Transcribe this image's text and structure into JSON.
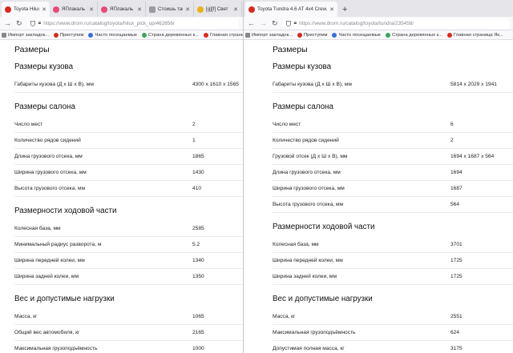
{
  "left": {
    "tabs": [
      {
        "title": "Toyota Hilux 1.9",
        "fav": "red",
        "active": true
      },
      {
        "title": "ЯПлакаль",
        "fav": "pink",
        "active": false
      },
      {
        "title": "ЯПлакаль - Р...",
        "fav": "pink",
        "active": false
      },
      {
        "title": "Стоишь так на...",
        "fav": "gray",
        "active": false
      },
      {
        "title": "[g][f] Свет",
        "fav": "yellow",
        "active": false
      }
    ],
    "url": "https://www.drom.ru/catalog/toyota/hilux_pick_up/462656/",
    "bookmarks": [
      {
        "label": "Импорт закладок...",
        "icon": "gray"
      },
      {
        "label": "Приступим",
        "icon": "red"
      },
      {
        "label": "Часто посещаемые",
        "icon": "blue"
      },
      {
        "label": "Страна деревянных к...",
        "icon": "green"
      },
      {
        "label": "Главная страница Як...",
        "icon": "red"
      }
    ],
    "page_title": "Размеры",
    "sections": [
      {
        "title": "Размеры кузова",
        "rows": [
          {
            "label": "Габариты кузова (Д х Ш х В), мм",
            "value": "4300 x 1610 x 1565"
          }
        ]
      },
      {
        "title": "Размеры салона",
        "rows": [
          {
            "label": "Число мест",
            "value": "2"
          },
          {
            "label": "Количество рядов сидений",
            "value": "1"
          },
          {
            "label": "Длина грузового отсека, мм",
            "value": "1865"
          },
          {
            "label": "Ширина грузового отсека, мм",
            "value": "1430"
          },
          {
            "label": "Высота грузового отсека, мм",
            "value": "410"
          }
        ]
      },
      {
        "title": "Размерности ходовой части",
        "rows": [
          {
            "label": "Колесная база, мм",
            "value": "2585"
          },
          {
            "label": "Минимальный радиус разворота, м",
            "value": "5.2"
          },
          {
            "label": "Ширина передней колеи, мм",
            "value": "1340"
          },
          {
            "label": "Ширина задней колеи, мм",
            "value": "1350"
          }
        ]
      },
      {
        "title": "Вес и допустимые нагрузки",
        "rows": [
          {
            "label": "Масса, кг",
            "value": "1065"
          },
          {
            "label": "Общий вес автомобиля, кг",
            "value": "2165"
          },
          {
            "label": "Максимальная грузоподъёмность",
            "value": "1000"
          }
        ]
      }
    ]
  },
  "right": {
    "tabs": [
      {
        "title": "Toyota Tundra 4.6 AT 4x4 Crew...",
        "fav": "red",
        "active": true
      }
    ],
    "url": "https://www.drom.ru/catalog/toyota/tundra/235458/",
    "bookmarks": [
      {
        "label": "Импорт закладок...",
        "icon": "gray"
      },
      {
        "label": "Приступим",
        "icon": "red"
      },
      {
        "label": "Часто посещаемые",
        "icon": "blue"
      },
      {
        "label": "Страна деревянных к...",
        "icon": "green"
      },
      {
        "label": "Главная страница Як...",
        "icon": "red"
      }
    ],
    "page_title": "Размеры",
    "sections": [
      {
        "title": "Размеры кузова",
        "rows": [
          {
            "label": "Габариты кузова (Д х Ш х В), мм",
            "value": "5814 x 2029 x 1941"
          }
        ]
      },
      {
        "title": "Размеры салона",
        "rows": [
          {
            "label": "Число мест",
            "value": "6"
          },
          {
            "label": "Количество рядов сидений",
            "value": "2"
          },
          {
            "label": "Грузовой отсек (Д х Ш х В), мм",
            "value": "1694 x 1687 x 564"
          },
          {
            "label": "Длина грузового отсека, мм",
            "value": "1694"
          },
          {
            "label": "Ширина грузового отсека, мм",
            "value": "1687"
          },
          {
            "label": "Высота грузового отсека, мм",
            "value": "564"
          }
        ]
      },
      {
        "title": "Размерности ходовой части",
        "rows": [
          {
            "label": "Колесная база, мм",
            "value": "3701"
          },
          {
            "label": "Ширина передней колеи, мм",
            "value": "1725"
          },
          {
            "label": "Ширина задней колеи, мм",
            "value": "1725"
          }
        ]
      },
      {
        "title": "Вес и допустимые нагрузки",
        "rows": [
          {
            "label": "Масса, кг",
            "value": "2551"
          },
          {
            "label": "Максимальная грузоподъёмность",
            "value": "624"
          },
          {
            "label": "Допустимая полная масса, кг",
            "value": "3175"
          }
        ]
      }
    ]
  }
}
